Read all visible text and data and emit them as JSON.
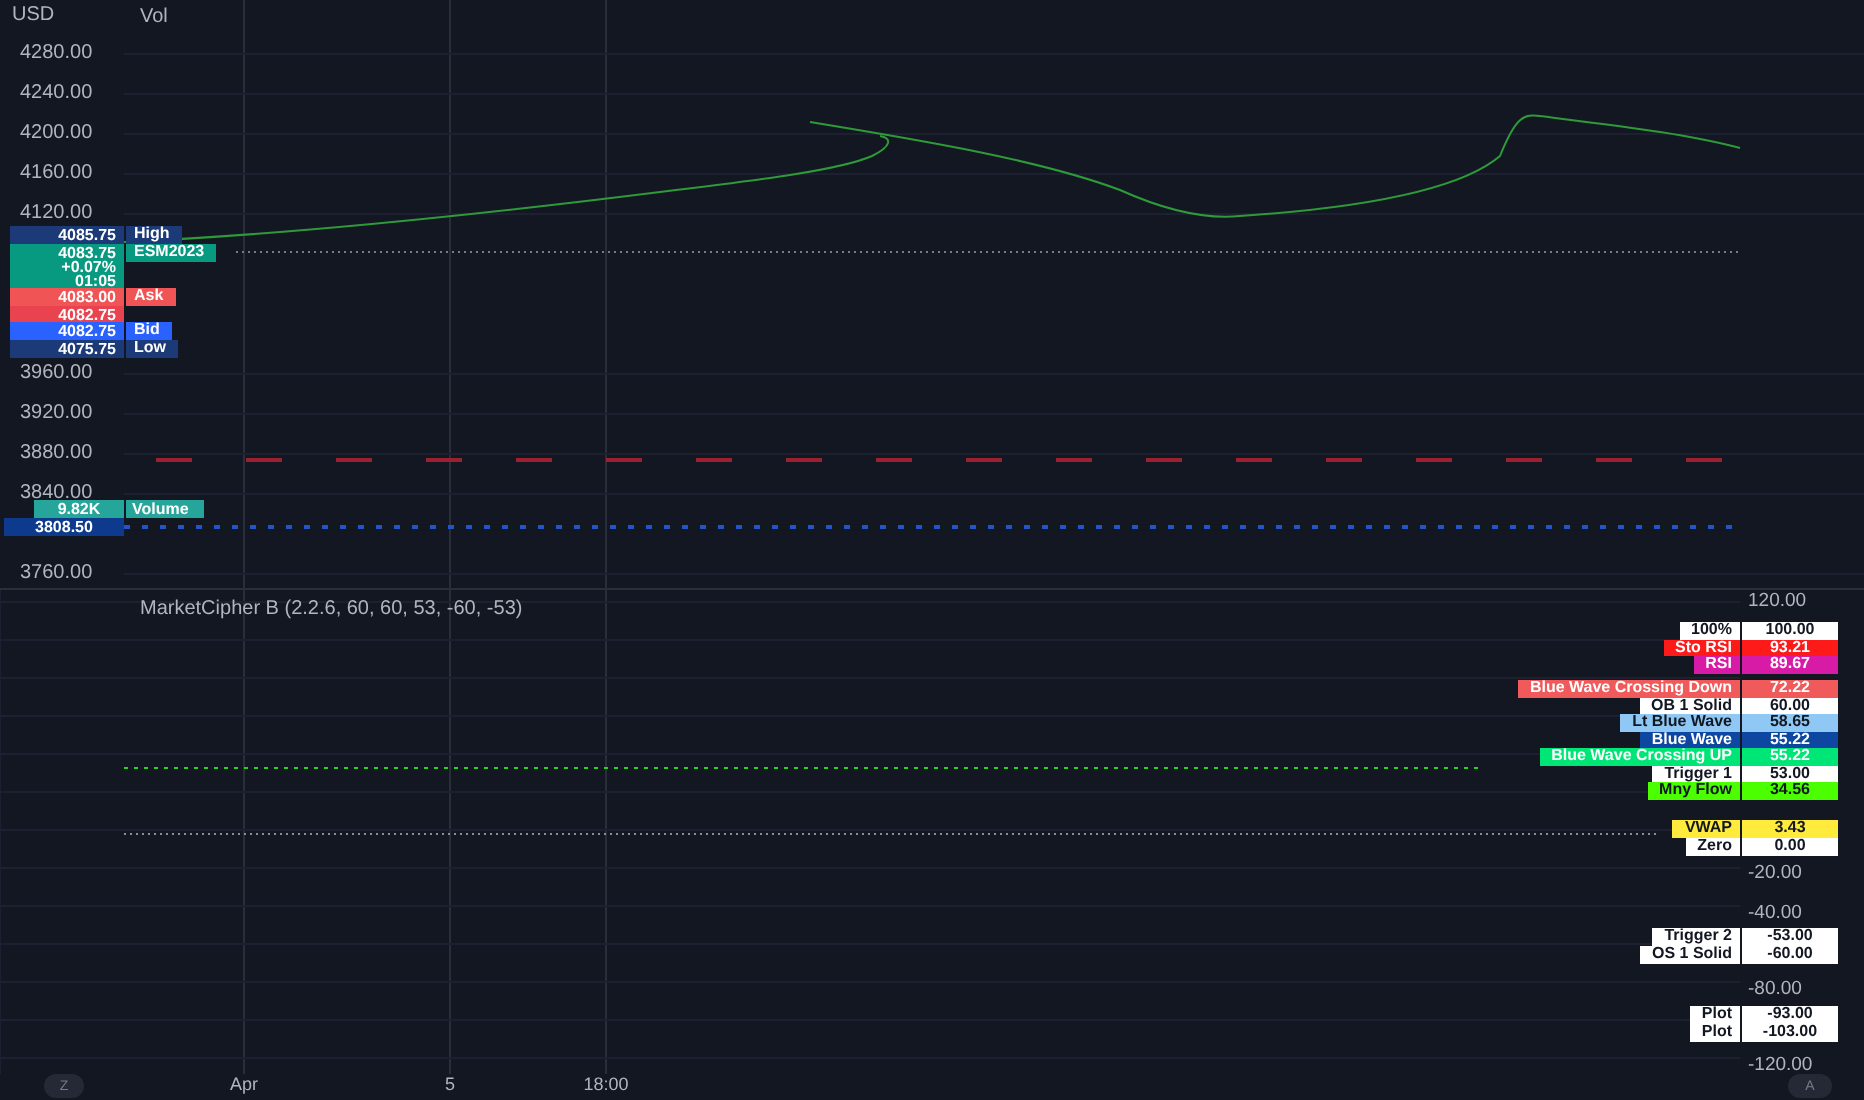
{
  "price_axis": {
    "unit": "USD",
    "ticks": [
      "4280.00",
      "4240.00",
      "4200.00",
      "4160.00",
      "4120.00",
      "3960.00",
      "3920.00",
      "3880.00",
      "3840.00",
      "3760.00"
    ]
  },
  "legend": {
    "label": "Vol"
  },
  "price_tags": [
    {
      "value": "4085.75",
      "label": "High",
      "color": "#1c3a78"
    },
    {
      "value": "4083.75",
      "lines": [
        "+0.07%",
        "01:05"
      ],
      "label": "ESM2023",
      "color": "#089981"
    },
    {
      "value": "4083.00",
      "label": "Ask",
      "color": "#f05454"
    },
    {
      "value": "4082.75",
      "color": "#e9434f"
    },
    {
      "value": "4082.75",
      "label": "Bid",
      "color": "#2962ff"
    },
    {
      "value": "4075.75",
      "label": "Low",
      "color": "#1c3a78"
    }
  ],
  "volume_tag": {
    "value": "9.82K",
    "label": "Volume"
  },
  "last_price_tag": {
    "value": "3808.50"
  },
  "indicator": {
    "title": "MarketCipher B (2.2.6, 60, 60, 53, -60, -53)",
    "axis_ticks": [
      "120.00",
      "-20.00",
      "-40.00",
      "-80.00",
      "-120.00"
    ],
    "labels": [
      {
        "name": "100%",
        "value": "100.00",
        "color": "#ffffff"
      },
      {
        "name": "Sto RSI",
        "value": "93.21",
        "color": "#ff1a1a"
      },
      {
        "name": "RSI",
        "value": "89.67",
        "color": "#d81ba6"
      },
      {
        "name": "Blue Wave Crossing Down",
        "value": "72.22",
        "color": "#f05a5a"
      },
      {
        "name": "OB 1 Solid",
        "value": "60.00",
        "color": "#ffffff"
      },
      {
        "name": "Lt Blue Wave",
        "value": "58.65",
        "color": "#90c8f5"
      },
      {
        "name": "Blue Wave",
        "value": "55.22",
        "color": "#0d47a1"
      },
      {
        "name": "Blue Wave Crossing UP",
        "value": "55.22",
        "color": "#00e676"
      },
      {
        "name": "Trigger 1",
        "value": "53.00",
        "color": "#ffffff"
      },
      {
        "name": "Mny Flow",
        "value": "34.56",
        "color": "#4cff00"
      },
      {
        "name": "VWAP",
        "value": "3.43",
        "color": "#ffeb3b"
      },
      {
        "name": "Zero",
        "value": "0.00",
        "color": "#ffffff"
      },
      {
        "name": "Trigger 2",
        "value": "-53.00",
        "color": "#ffffff"
      },
      {
        "name": "OS 1 Solid",
        "value": "-60.00",
        "color": "#ffffff"
      },
      {
        "name": "Plot",
        "value": "-93.00",
        "color": "#ffffff"
      },
      {
        "name": "Plot",
        "value": "-103.00",
        "color": "#ffffff"
      }
    ]
  },
  "time_axis": {
    "ticks": [
      "Apr",
      "5",
      "18:00"
    ]
  },
  "z_button": "Z",
  "auto_button": "A"
}
